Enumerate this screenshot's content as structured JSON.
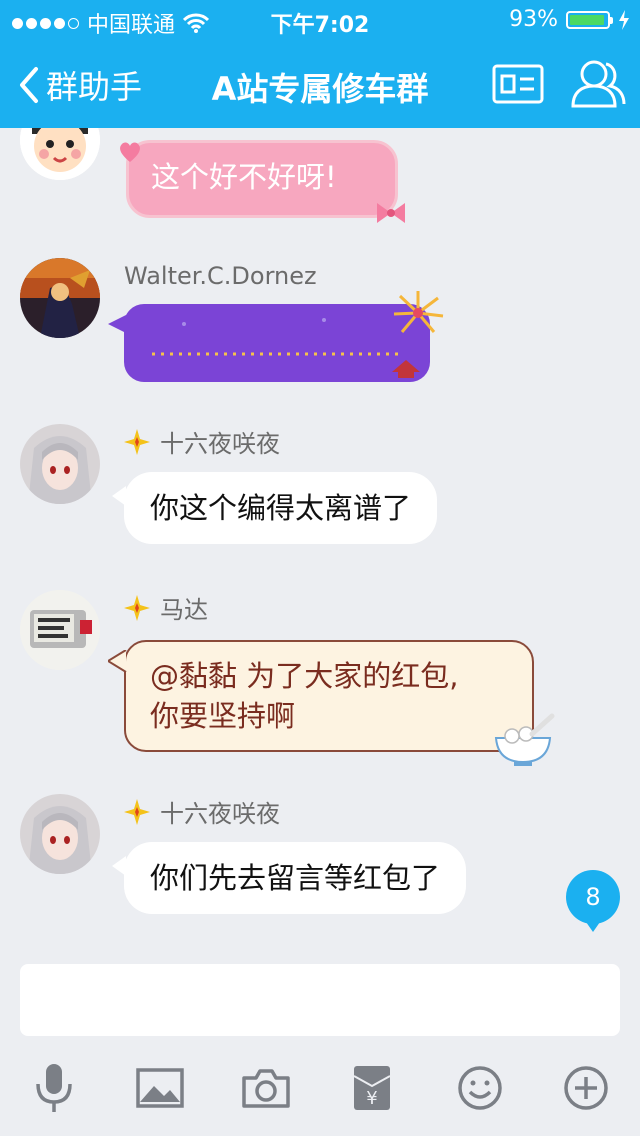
{
  "status_bar": {
    "carrier": "中国联通",
    "time": "下午7:02",
    "battery_percent": "93%"
  },
  "nav": {
    "back_label": "群助手",
    "title": "A站专属修车群"
  },
  "messages": [
    {
      "type": "pink",
      "text": "这个好不好呀!"
    },
    {
      "type": "purple",
      "sender": "Walter.C.Dornez"
    },
    {
      "type": "white",
      "sender": "十六夜咲夜",
      "text": "你这个编得太离谱了"
    },
    {
      "type": "cream",
      "sender": "马达",
      "line1": "@黏黏 为了大家的红包,",
      "line2": "你要坚持啊"
    },
    {
      "type": "white",
      "sender": "十六夜咲夜",
      "text": "你们先去留言等红包了"
    }
  ],
  "unread_badge": "8",
  "toolbar": {
    "items": [
      "microphone-icon",
      "image-icon",
      "camera-icon",
      "red-packet-icon",
      "emoji-icon",
      "plus-icon"
    ]
  },
  "colors": {
    "accent": "#1bb0f0",
    "background": "#eceef2"
  }
}
